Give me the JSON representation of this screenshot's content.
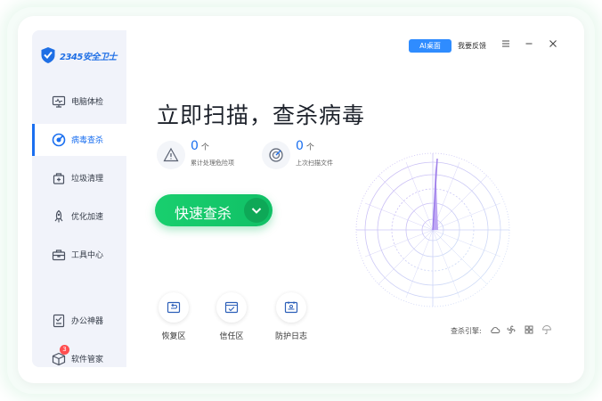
{
  "app": {
    "logo_text": "2345安全卫士",
    "brand_color": "#1f6fe5",
    "accent_green": "#19cf6e"
  },
  "sidebar": {
    "items": [
      {
        "label": "电脑体检",
        "icon": "monitor-icon"
      },
      {
        "label": "病毒查杀",
        "icon": "virus-scan-icon",
        "active": true
      },
      {
        "label": "垃圾清理",
        "icon": "trash-bag-icon"
      },
      {
        "label": "优化加速",
        "icon": "rocket-icon"
      },
      {
        "label": "工具中心",
        "icon": "toolbox-icon"
      },
      {
        "label": "办公神器",
        "icon": "office-icon"
      },
      {
        "label": "软件管家",
        "icon": "box-icon",
        "badge": "3"
      }
    ]
  },
  "topbar": {
    "ai_label": "AI桌面",
    "feedback_label": "我要反馈"
  },
  "main": {
    "headline": "立即扫描，查杀病毒",
    "stats": [
      {
        "value": "0",
        "unit": "个",
        "label": "累计处理危险项",
        "icon": "warning-icon"
      },
      {
        "value": "0",
        "unit": "个",
        "label": "上次扫描文件",
        "icon": "radar-icon"
      }
    ],
    "scan_button": "快速查杀",
    "tools": [
      {
        "label": "恢复区",
        "icon": "restore-icon"
      },
      {
        "label": "信任区",
        "icon": "trust-icon"
      },
      {
        "label": "防护日志",
        "icon": "log-icon"
      }
    ],
    "engine_label": "查杀引擎:",
    "engines": [
      "cloud-icon",
      "fan-icon",
      "grid-icon",
      "umbrella-icon"
    ]
  }
}
